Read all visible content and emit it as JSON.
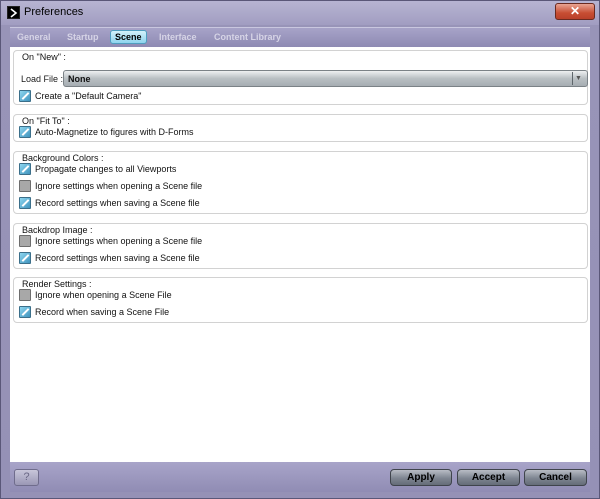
{
  "window": {
    "title": "Preferences",
    "close_label": "✕"
  },
  "tabs": [
    {
      "label": "General",
      "active": false
    },
    {
      "label": "Startup",
      "active": false
    },
    {
      "label": "Scene",
      "active": true
    },
    {
      "label": "Interface",
      "active": false
    },
    {
      "label": "Content Library",
      "active": false
    }
  ],
  "groups": {
    "on_new": {
      "title": "On \"New\" :",
      "load_file_label": "Load File :",
      "load_file_value": "None",
      "items": [
        {
          "label": "Create a \"Default Camera\"",
          "checked": true
        }
      ]
    },
    "on_fit_to": {
      "title": "On \"Fit To\" :",
      "items": [
        {
          "label": "Auto-Magnetize to figures with D-Forms",
          "checked": true
        }
      ]
    },
    "background_colors": {
      "title": "Background Colors :",
      "items": [
        {
          "label": "Propagate changes to all Viewports",
          "checked": true
        },
        {
          "label": "Ignore settings when opening a Scene file",
          "checked": false
        },
        {
          "label": "Record settings when saving a Scene file",
          "checked": true
        }
      ]
    },
    "backdrop_image": {
      "title": "Backdrop Image :",
      "items": [
        {
          "label": "Ignore settings when opening a Scene file",
          "checked": false
        },
        {
          "label": "Record settings when saving a Scene file",
          "checked": true
        }
      ]
    },
    "render_settings": {
      "title": "Render Settings :",
      "items": [
        {
          "label": "Ignore when opening a Scene File",
          "checked": false
        },
        {
          "label": "Record when saving a Scene File",
          "checked": true
        }
      ]
    }
  },
  "buttons": {
    "help": "?",
    "apply": "Apply",
    "accept": "Accept",
    "cancel": "Cancel"
  },
  "colors": {
    "active_tab": "#8fd4ee",
    "checkbox_checked": "#3f93bd",
    "close": "#c74d33"
  }
}
